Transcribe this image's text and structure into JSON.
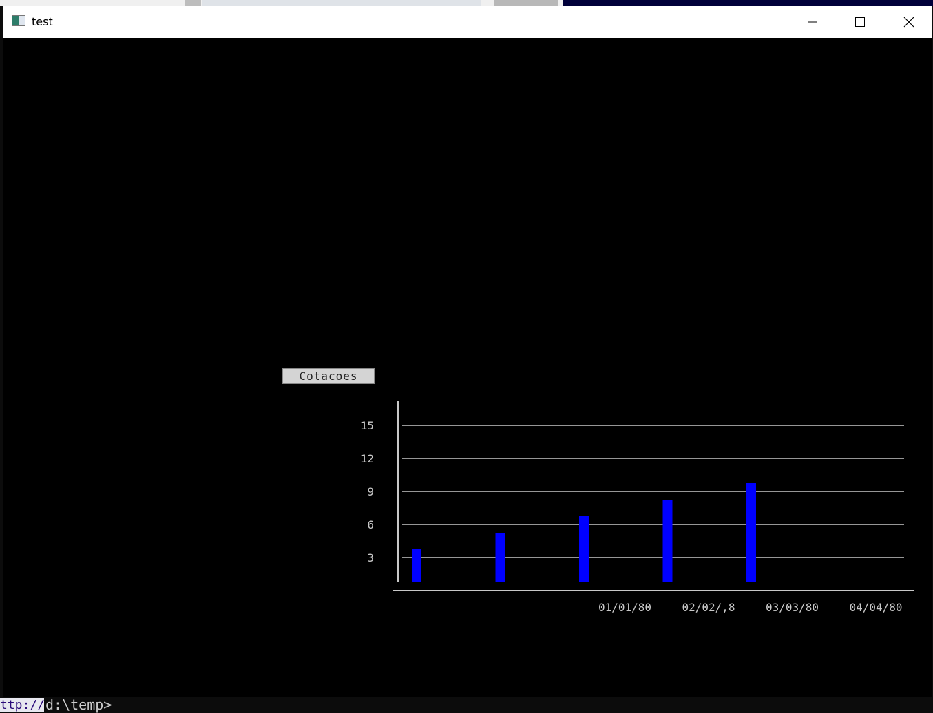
{
  "window": {
    "title": "test",
    "minimize_icon": "minimize-icon",
    "maximize_icon": "maximize-icon",
    "close_icon": "close-icon"
  },
  "console": {
    "link_fragment": "ttp://",
    "prompt": "d:\\temp>"
  },
  "chart_data": {
    "type": "bar",
    "legend": "Cotacoes",
    "categories": [
      "",
      "",
      "",
      "",
      ""
    ],
    "values": [
      3.75,
      5.25,
      6.75,
      8.25,
      9.75
    ],
    "yticks": [
      "3",
      "6",
      "9",
      "12",
      "15"
    ],
    "ytick_values": [
      3,
      6,
      9,
      12,
      15
    ],
    "xlabels": [
      "01/01/80",
      "02/02/,8",
      "03/03/80",
      "04/04/80"
    ],
    "ylim": [
      0,
      16.5
    ],
    "grid": true,
    "bar_color": "#0000ff",
    "grid_color": "#c8c8c8"
  }
}
